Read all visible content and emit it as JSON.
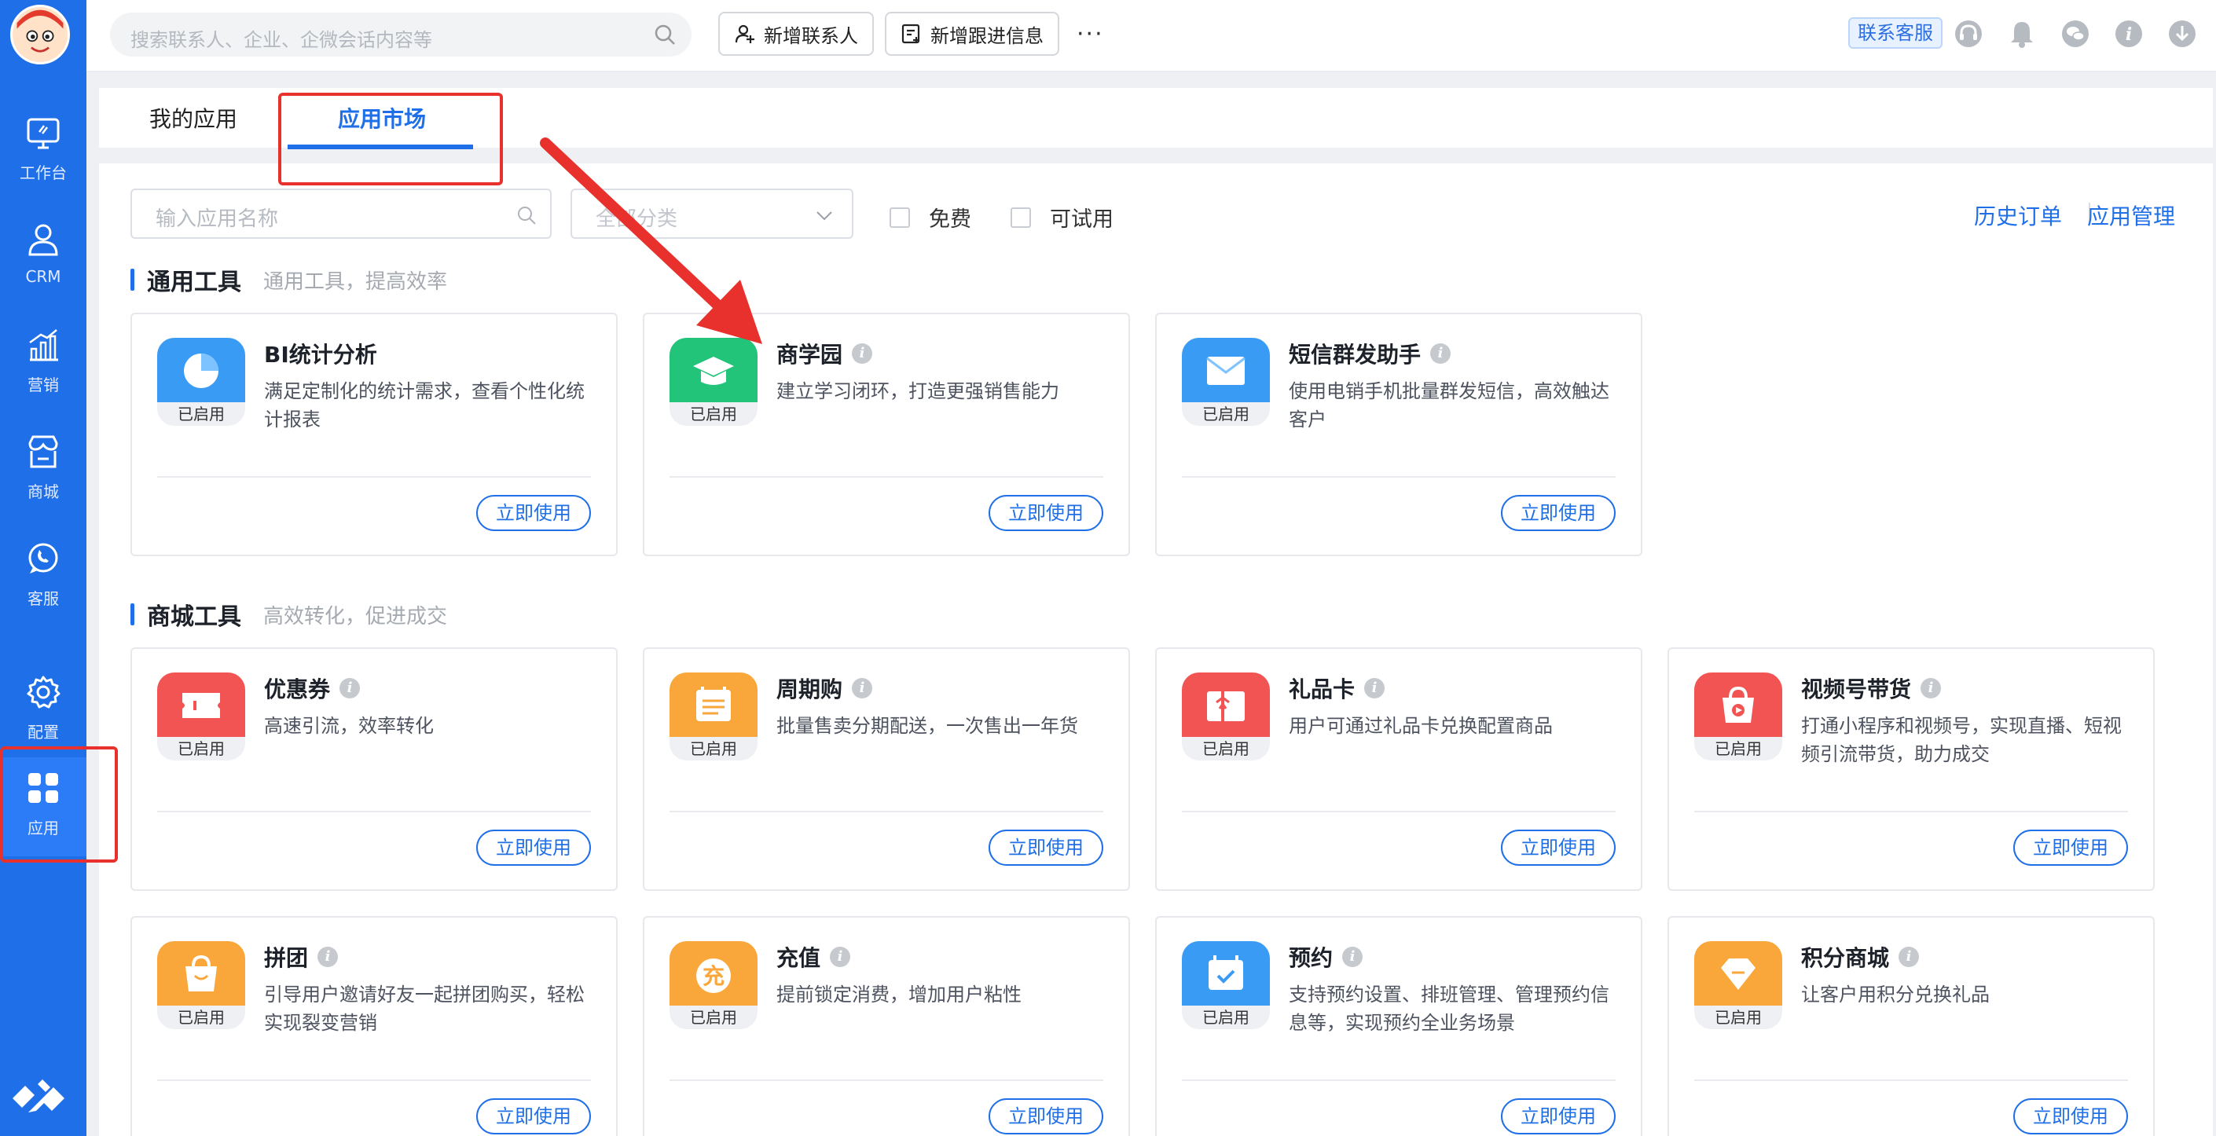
{
  "sidebar": {
    "items": [
      {
        "label": "工作台",
        "icon": "monitor-icon"
      },
      {
        "label": "CRM",
        "icon": "user-icon"
      },
      {
        "label": "营销",
        "icon": "chart-icon"
      },
      {
        "label": "商城",
        "icon": "store-icon"
      },
      {
        "label": "客服",
        "icon": "chat-icon"
      },
      {
        "label": "配置",
        "icon": "gear-icon"
      },
      {
        "label": "应用",
        "icon": "apps-icon"
      }
    ]
  },
  "topbar": {
    "search_placeholder": "搜索联系人、企业、企微会话内容等",
    "add_contact": "新增联系人",
    "add_followup": "新增跟进信息",
    "more": "···",
    "contact_service": "联系客服"
  },
  "tabs": [
    {
      "label": "我的应用"
    },
    {
      "label": "应用市场"
    }
  ],
  "filters": {
    "app_name_placeholder": "输入应用名称",
    "category_placeholder": "全部分类",
    "free_label": "免费",
    "trial_label": "可试用",
    "history_orders": "历史订单",
    "app_manage": "应用管理"
  },
  "sections": [
    {
      "title": "通用工具",
      "subtitle": "通用工具，提高效率",
      "apps": [
        {
          "name": "BI统计分析",
          "desc": "满足定制化的统计需求，查看个性化统计报表",
          "status": "已启用",
          "action": "立即使用",
          "color": "#3a9bf5",
          "icon": "pie-chart-icon",
          "info": false
        },
        {
          "name": "商学园",
          "desc": "建立学习闭环，打造更强销售能力",
          "status": "已启用",
          "action": "立即使用",
          "color": "#22c47a",
          "icon": "graduation-cap-icon",
          "info": true
        },
        {
          "name": "短信群发助手",
          "desc": "使用电销手机批量群发短信，高效触达客户",
          "status": "已启用",
          "action": "立即使用",
          "color": "#3a9bf5",
          "icon": "envelope-icon",
          "info": true
        }
      ]
    },
    {
      "title": "商城工具",
      "subtitle": "高效转化，促进成交",
      "apps": [
        {
          "name": "优惠券",
          "desc": "高速引流，效率转化",
          "status": "已启用",
          "action": "立即使用",
          "color": "#f25454",
          "icon": "ticket-icon",
          "info": true
        },
        {
          "name": "周期购",
          "desc": "批量售卖分期配送，一次售出一年货",
          "status": "已启用",
          "action": "立即使用",
          "color": "#f9a63a",
          "icon": "calendar-list-icon",
          "info": true
        },
        {
          "name": "礼品卡",
          "desc": "用户可通过礼品卡兑换配置商品",
          "status": "已启用",
          "action": "立即使用",
          "color": "#f25454",
          "icon": "gift-card-icon",
          "info": true
        },
        {
          "name": "视频号带货",
          "desc": "打通小程序和视频号，实现直播、短视频引流带货，助力成交",
          "status": "已启用",
          "action": "立即使用",
          "color": "#f25454",
          "icon": "video-bag-icon",
          "info": true
        },
        {
          "name": "拼团",
          "desc": "引导用户邀请好友一起拼团购买，轻松实现裂变营销",
          "status": "已启用",
          "action": "立即使用",
          "color": "#f9a63a",
          "icon": "group-bag-icon",
          "info": true
        },
        {
          "name": "充值",
          "desc": "提前锁定消费，增加用户粘性",
          "status": "已启用",
          "action": "立即使用",
          "color": "#f9a63a",
          "icon": "recharge-coin-icon",
          "info": true,
          "glyph_text": "充"
        },
        {
          "name": "预约",
          "desc": "支持预约设置、排班管理、管理预约信息等，实现预约全业务场景",
          "status": "已启用",
          "action": "立即使用",
          "color": "#3a9bf5",
          "icon": "calendar-check-icon",
          "info": true
        },
        {
          "name": "积分商城",
          "desc": "让客户用积分兑换礼品",
          "status": "已启用",
          "action": "立即使用",
          "color": "#f9a63a",
          "icon": "diamond-icon",
          "info": true
        }
      ]
    }
  ]
}
